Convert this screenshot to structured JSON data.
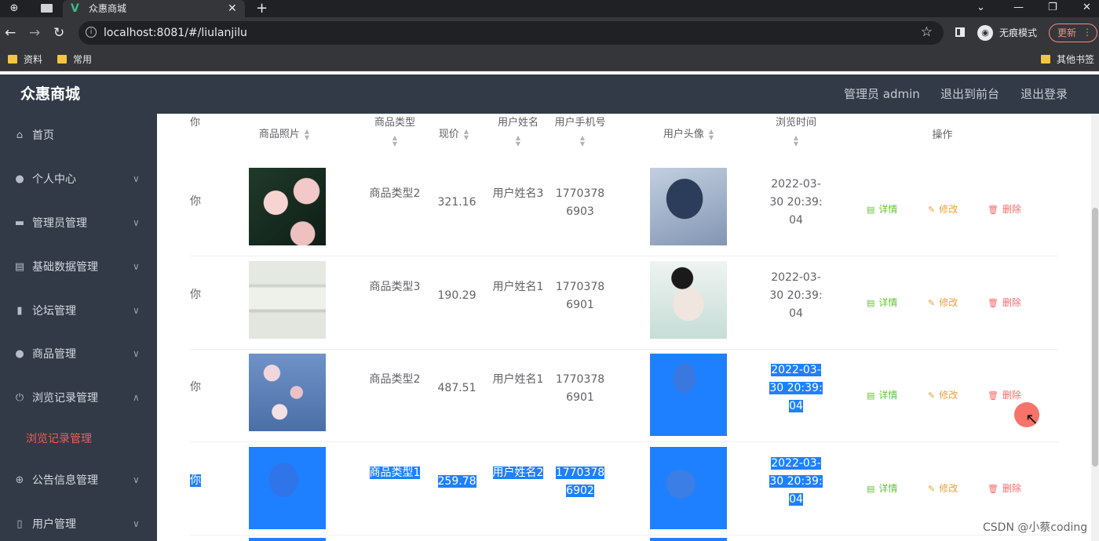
{
  "browser": {
    "tab_title": "众惠商城",
    "url": "localhost:8081/#/liulanjilu",
    "incognito_label": "无痕模式",
    "update_label": "更新",
    "bookmarks": [
      "资料",
      "常用"
    ],
    "other_bookmarks": "其他书签"
  },
  "header": {
    "brand": "众惠商城",
    "admin_label": "管理员 admin",
    "front_link": "退出到前台",
    "logout_link": "退出登录"
  },
  "sidebar": {
    "items": [
      {
        "label": "首页",
        "icon": "home-icon"
      },
      {
        "label": "个人中心",
        "icon": "user-icon"
      },
      {
        "label": "管理员管理",
        "icon": "chat-icon"
      },
      {
        "label": "基础数据管理",
        "icon": "clipboard-icon"
      },
      {
        "label": "论坛管理",
        "icon": "bar-chart-icon"
      },
      {
        "label": "商品管理",
        "icon": "user-icon"
      },
      {
        "label": "浏览记录管理",
        "icon": "power-icon"
      },
      {
        "label": "公告信息管理",
        "icon": "compass-icon"
      },
      {
        "label": "用户管理",
        "icon": "phone-icon"
      }
    ],
    "active_sub": "浏览记录管理"
  },
  "table": {
    "headers": {
      "name": "你",
      "photo": "商品照片",
      "type": "商品类型",
      "price": "现价",
      "user_name": "用户姓名",
      "phone": "用户手机号",
      "avatar": "用户头像",
      "time": "浏览时间",
      "ops": "操作"
    },
    "actions": {
      "detail": "详情",
      "edit": "修改",
      "delete": "删除"
    },
    "rows": [
      {
        "name": "你",
        "type": "商品类型2",
        "price": "321.16",
        "user_name": "用户姓名3",
        "phone": "17703786903",
        "time": "2022-03-30 20:39:04"
      },
      {
        "name": "你",
        "type": "商品类型3",
        "price": "190.29",
        "user_name": "用户姓名1",
        "phone": "17703786901",
        "time": "2022-03-30 20:39:04"
      },
      {
        "name": "你",
        "type": "商品类型2",
        "price": "487.51",
        "user_name": "用户姓名1",
        "phone": "17703786901",
        "time": "2022-03-30 20:39:04"
      },
      {
        "name": "你",
        "type": "商品类型1",
        "price": "259.78",
        "user_name": "用户姓名2",
        "phone": "17703786902",
        "time": "2022-03-30 20:39:04"
      }
    ]
  },
  "watermark": "CSDN @小蔡coding",
  "colors": {
    "sidebar_bg": "#313a46",
    "active_sub": "#f25c54",
    "selection": "#1e80ff",
    "detail": "#67c23a",
    "edit": "#e6a23c",
    "delete": "#f56c6c"
  }
}
